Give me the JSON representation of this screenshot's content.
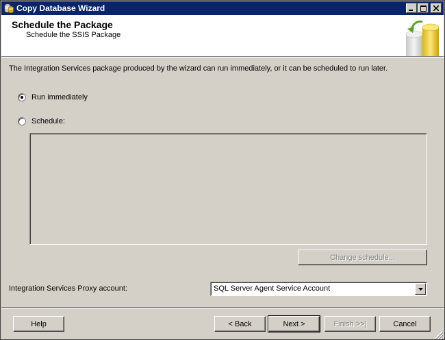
{
  "window": {
    "title": "Copy Database Wizard",
    "icon": "wizard-db-icon",
    "controls": [
      "minimize-icon",
      "maximize-icon",
      "close-icon"
    ]
  },
  "header": {
    "title": "Schedule the Package",
    "subtitle": "Schedule the SSIS Package",
    "art_icon": "database-wizard-art-icon"
  },
  "description": "The Integration Services package produced by the wizard can run immediately, or it can be scheduled to run later.",
  "run_options": {
    "immediately_label": "Run immediately",
    "schedule_label": "Schedule:",
    "selected": "Run immediately"
  },
  "change_schedule_label": "Change schedule...",
  "proxy": {
    "label": "Integration Services Proxy account:",
    "value": "SQL Server Agent Service Account"
  },
  "footer": {
    "help": "Help",
    "back": "< Back",
    "next": "Next >",
    "finish": "Finish >>|",
    "cancel": "Cancel"
  },
  "colors": {
    "titlebar": "#0a246a",
    "face": "#d4d0c8",
    "header_bg": "#ffffff"
  }
}
